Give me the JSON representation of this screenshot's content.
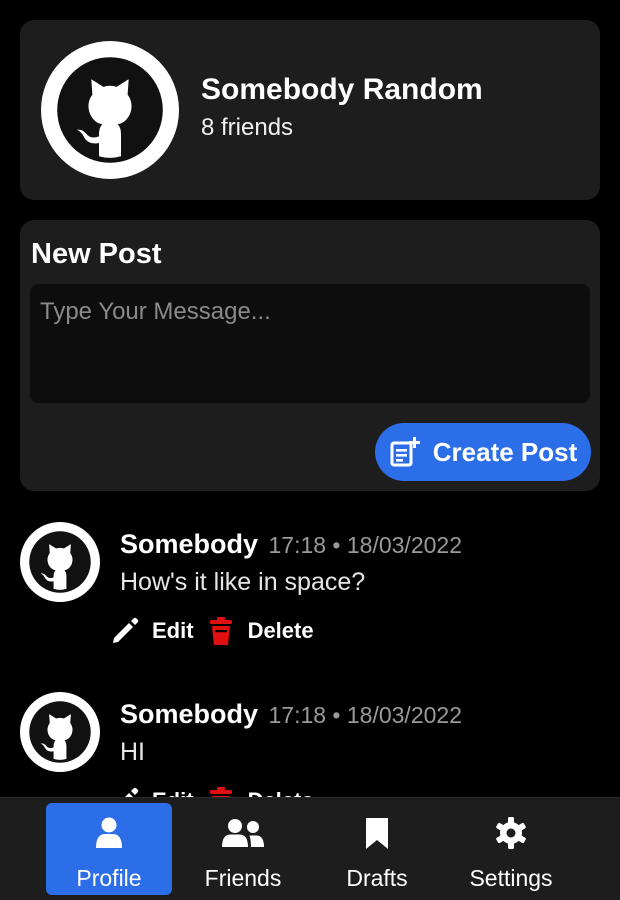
{
  "profile": {
    "name": "Somebody Random",
    "friends": "8 friends",
    "avatar_icon": "github-octocat-icon"
  },
  "new_post": {
    "title": "New Post",
    "placeholder": "Type Your Message...",
    "value": "",
    "create_label": "Create Post",
    "create_icon": "post-add-icon",
    "accent": "#2c6ee8"
  },
  "posts": [
    {
      "author": "Somebody",
      "meta": "17:18 • 18/03/2022",
      "text": "How's it like in space?",
      "edit_label": "Edit",
      "delete_label": "Delete"
    },
    {
      "author": "Somebody",
      "meta": "17:18 • 18/03/2022",
      "text": "HI",
      "edit_label": "Edit",
      "delete_label": "Delete"
    }
  ],
  "nav": {
    "items": [
      {
        "label": "Profile",
        "icon": "user-icon",
        "active": true
      },
      {
        "label": "Friends",
        "icon": "users-icon",
        "active": false
      },
      {
        "label": "Drafts",
        "icon": "bookmark-icon",
        "active": false
      },
      {
        "label": "Settings",
        "icon": "gear-icon",
        "active": false
      }
    ]
  },
  "colors": {
    "background": "#000000",
    "card": "#1d1d1d",
    "delete_red": "#e01010"
  }
}
